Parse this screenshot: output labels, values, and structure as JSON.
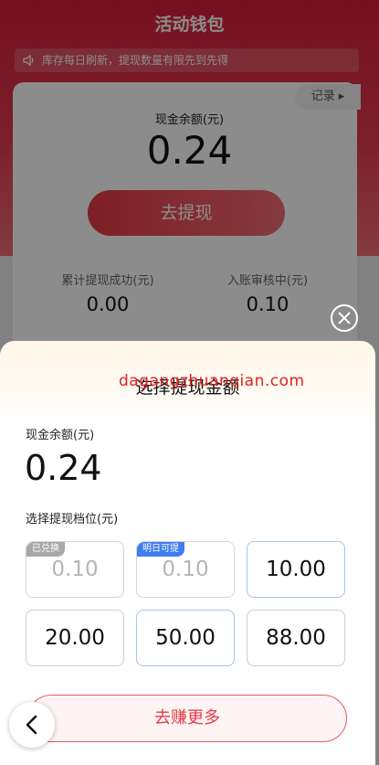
{
  "background_page": {
    "title": "活动钱包",
    "notice": "库存每日刷新，提现数量有限先到先得",
    "record_link": "记录 ▸",
    "cash_balance_label": "现金余额(元)",
    "cash_balance_value": "0.24",
    "withdraw_button": "去提现",
    "stats": [
      {
        "label": "累计提现成功(元)",
        "value": "0.00"
      },
      {
        "label": "入账审核中(元)",
        "value": "0.10"
      }
    ]
  },
  "sheet": {
    "title": "选择提现金额",
    "watermark": "dagangzhuanqian.com",
    "balance_label": "现金余额(元)",
    "balance_value": "0.24",
    "tier_label": "选择提现档位(元)",
    "tiers": [
      {
        "amount": "0.10",
        "badge": "已兑换",
        "state": "redeemed"
      },
      {
        "amount": "0.10",
        "badge": "明日可提",
        "state": "tomorrow"
      },
      {
        "amount": "10.00",
        "badge": "",
        "state": "available"
      },
      {
        "amount": "20.00",
        "badge": "",
        "state": "available"
      },
      {
        "amount": "50.00",
        "badge": "",
        "state": "available"
      },
      {
        "amount": "88.00",
        "badge": "",
        "state": "available"
      }
    ],
    "earn_more_button": "去赚更多"
  },
  "icons": {
    "close": "close-icon",
    "back": "chevron-left-icon",
    "speaker": "speaker-icon"
  },
  "colors": {
    "accent_red": "#e23a46",
    "badge_blue": "#3f7df0",
    "badge_gray": "#a8a8a8"
  }
}
